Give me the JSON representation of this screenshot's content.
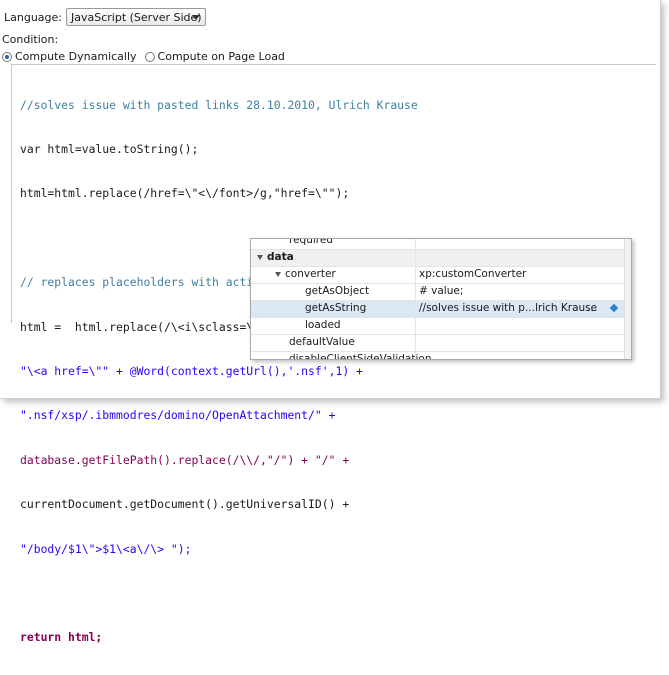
{
  "language": {
    "label": "Language:",
    "selected": "JavaScript (Server Side)"
  },
  "condition": {
    "label": "Condition:",
    "options": [
      {
        "label": "Compute Dynamically",
        "checked": true
      },
      {
        "label": "Compute on Page Load",
        "checked": false
      }
    ]
  },
  "code_lines": [
    "//solves issue with pasted links 28.10.2010, Ulrich Krause",
    "var html=value.toString();",
    "html=html.replace(/href=\\\"<\\/font>/g,\"href=\\\"\");",
    "",
    "// replaces placeholders with active links to attachments",
    "html =  html.replace(/\\<i\\sclass=\\\"domino-attachment-ref\\\"\\>\\(.*\\:\\s(.+?)\\)\\<\\/i\\>/g,",
    "\"\\<a href=\\\"\" + @Word(context.getUrl(),'.nsf',1) +",
    "\".nsf/xsp/.ibmmodres/domino/OpenAttachment/\" +",
    "database.getFilePath().replace(/\\\\/,\"/\") + \"/\" +",
    "currentDocument.getDocument().getUniversalID() +",
    "\"/body/$1\\\">$1\\<a\\/\\> \");",
    "",
    "return html;"
  ],
  "properties": {
    "rows": [
      {
        "name": "required",
        "value": ""
      },
      {
        "name": "data",
        "value": "",
        "category": true
      },
      {
        "name": "converter",
        "value": "xp:customConverter"
      },
      {
        "name": "getAsObject",
        "value": "# value;"
      },
      {
        "name": "getAsString",
        "value": "//solves issue with p...lrich Krause",
        "selected": true,
        "button": "..."
      },
      {
        "name": "loaded",
        "value": ""
      },
      {
        "name": "defaultValue",
        "value": ""
      },
      {
        "name": "disableClientSideValidation",
        "value": ""
      }
    ]
  }
}
